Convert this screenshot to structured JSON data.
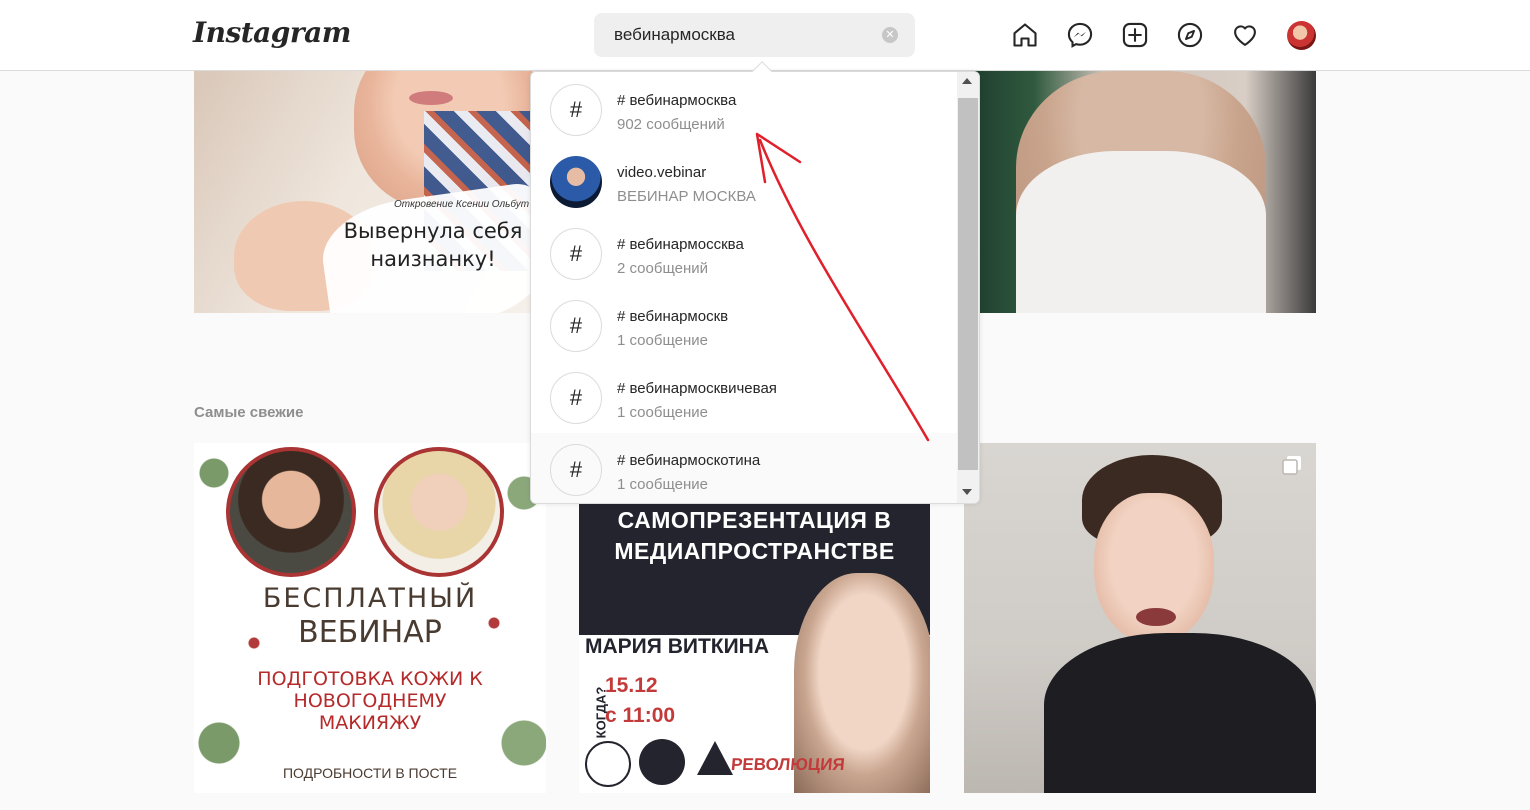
{
  "header": {
    "logo": "Instagram",
    "search": {
      "value": "вебинармосква",
      "clear_symbol": "✕"
    }
  },
  "nav": {
    "icons": [
      "home-icon",
      "messenger-icon",
      "new-post-icon",
      "explore-icon",
      "activity-heart-icon",
      "profile-avatar"
    ]
  },
  "search_results": [
    {
      "type": "hashtag",
      "icon": "#",
      "title": "# вебинармосква",
      "subtitle": "902 сообщений"
    },
    {
      "type": "account",
      "title": "video.vebinar",
      "subtitle": "ВЕБИНАР МОСКВА"
    },
    {
      "type": "hashtag",
      "icon": "#",
      "title": "# вебинармоссква",
      "subtitle": "2 сообщений"
    },
    {
      "type": "hashtag",
      "icon": "#",
      "title": "# вебинармоскв",
      "subtitle": "1 сообщение"
    },
    {
      "type": "hashtag",
      "icon": "#",
      "title": "# вебинармосквичевая",
      "subtitle": "1 сообщение"
    },
    {
      "type": "hashtag",
      "icon": "#",
      "title": "# вебинармоскотина",
      "subtitle": "1 сообщение"
    }
  ],
  "section": {
    "recent_title": "Самые свежие"
  },
  "posts": {
    "top_left": {
      "caption_small": "Откровение Ксении Ольбут",
      "caption_big": "Вывернула себя наизнанку!"
    },
    "recent_1": {
      "line1": "БЕСПЛАТНЫЙ",
      "line2": "ВЕБИНАР",
      "line3": "ПОДГОТОВКА КОЖИ К НОВОГОДНЕМУ МАКИЯЖУ",
      "line4": "ПОДРОБНОСТИ В ПОСТЕ"
    },
    "recent_2": {
      "headline": "САМОПРЕЗЕНТАЦИЯ В МЕДИАПРОСТРАНСТВЕ",
      "name": "МАРИЯ ВИТКИНА",
      "when_label": "КОГДА?",
      "date": "15.12",
      "time": "с 11:00",
      "brand": "РЕВОЛЮЦИЯ"
    }
  },
  "annotation": {
    "arrow_color": "#e0202a"
  }
}
